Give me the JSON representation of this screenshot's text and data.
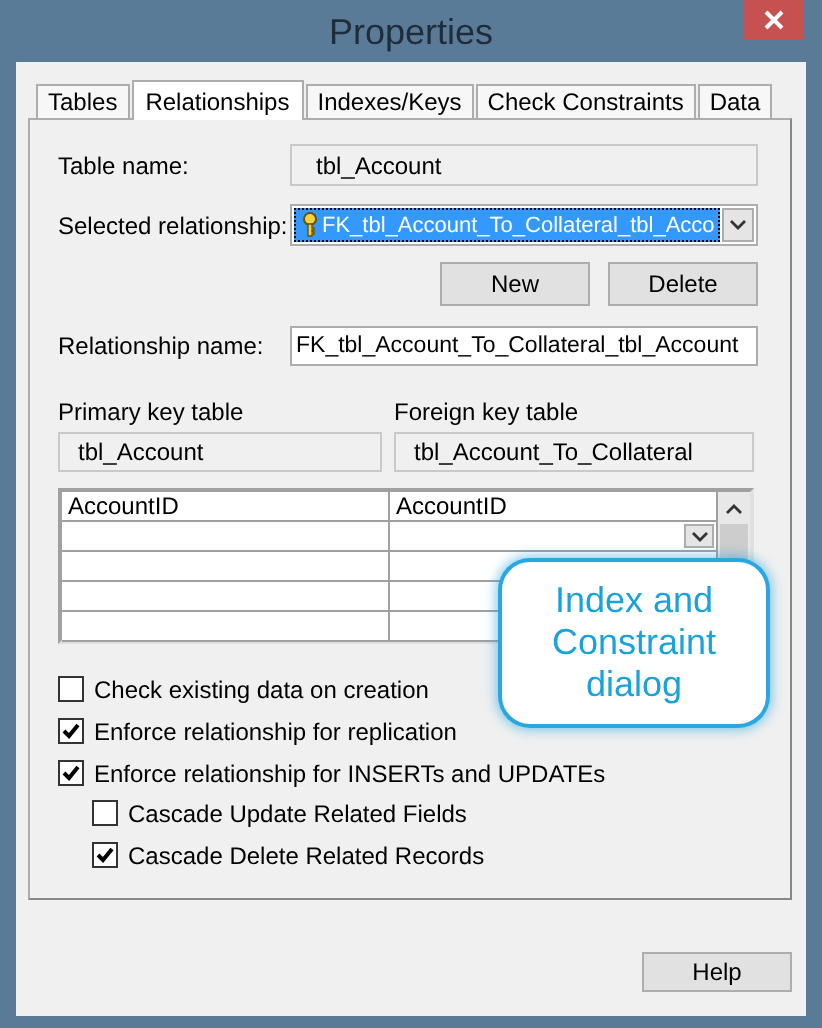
{
  "window": {
    "title": "Properties"
  },
  "tabs": [
    {
      "label": "Tables",
      "selected": false
    },
    {
      "label": "Relationships",
      "selected": true
    },
    {
      "label": "Indexes/Keys",
      "selected": false
    },
    {
      "label": "Check Constraints",
      "selected": false
    },
    {
      "label": "Data",
      "selected": false
    }
  ],
  "table_name": {
    "label": "Table name:",
    "value": "tbl_Account"
  },
  "selected_relationship": {
    "label": "Selected relationship:",
    "value": "FK_tbl_Account_To_Collateral_tbl_Acco"
  },
  "buttons": [
    "New",
    "Delete"
  ],
  "relationship_name": {
    "label": "Relationship name:",
    "value": "FK_tbl_Account_To_Collateral_tbl_Account"
  },
  "primary_key_table": {
    "label": "Primary key table",
    "value": "tbl_Account"
  },
  "foreign_key_table": {
    "label": "Foreign key table",
    "value": "tbl_Account_To_Collateral"
  },
  "key_grid": {
    "rows": [
      {
        "primary_key": "AccountID",
        "foreign_key": "AccountID"
      }
    ]
  },
  "options": [
    {
      "label": "Check existing data on creation",
      "checked": false
    },
    {
      "label": "Enforce relationship for replication",
      "checked": true
    },
    {
      "label": "Enforce relationship for INSERTs and UPDATEs",
      "checked": true,
      "children": [
        {
          "label": "Cascade Update Related Fields",
          "checked": false
        },
        {
          "label": "Cascade Delete Related Records",
          "checked": true
        }
      ]
    }
  ],
  "callout": {
    "text": "Index and Constraint dialog"
  },
  "help_button": "Help"
}
